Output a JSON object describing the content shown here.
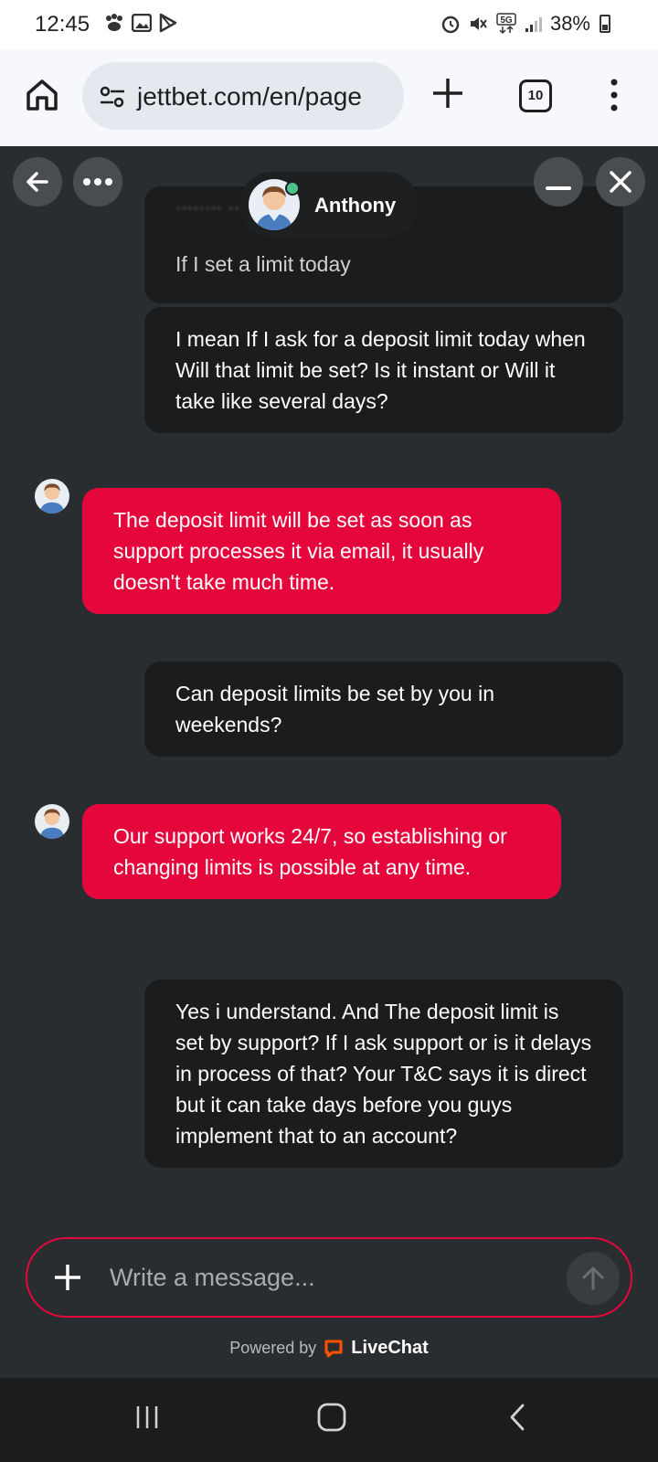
{
  "status_bar": {
    "time": "12:45",
    "battery": "38%"
  },
  "browser": {
    "url": "jettbet.com/en/page",
    "tab_count": "10"
  },
  "chat_header": {
    "agent_name": "Anthony"
  },
  "messages": [
    {
      "from": "user",
      "text": "If I set a limit today",
      "partial": true
    },
    {
      "from": "user",
      "text": "I mean If I ask for a deposit limit today when Will that limit be set? Is it instant or Will it take like several days?"
    },
    {
      "from": "agent",
      "text": "The deposit limit will be set as soon as support processes it via email, it usually doesn't take much time."
    },
    {
      "from": "user",
      "text": "Can deposit limits be set by you in weekends?"
    },
    {
      "from": "agent",
      "text": "Our support works 24/7, so establishing or changing limits is possible at any time."
    },
    {
      "from": "user",
      "text": "Yes i understand. And The deposit limit is set by support? If I ask support or is it delays in process of that? Your T&C says it is direct but it can take days before you guys implement that to an account?"
    }
  ],
  "composer": {
    "placeholder": "Write a message..."
  },
  "footer": {
    "powered_by": "Powered by",
    "brand": "LiveChat"
  },
  "colors": {
    "agent_bubble": "#e5063c",
    "user_bubble": "#1a1c1e",
    "chat_bg": "#2a2d30",
    "online": "#4cc38a"
  }
}
